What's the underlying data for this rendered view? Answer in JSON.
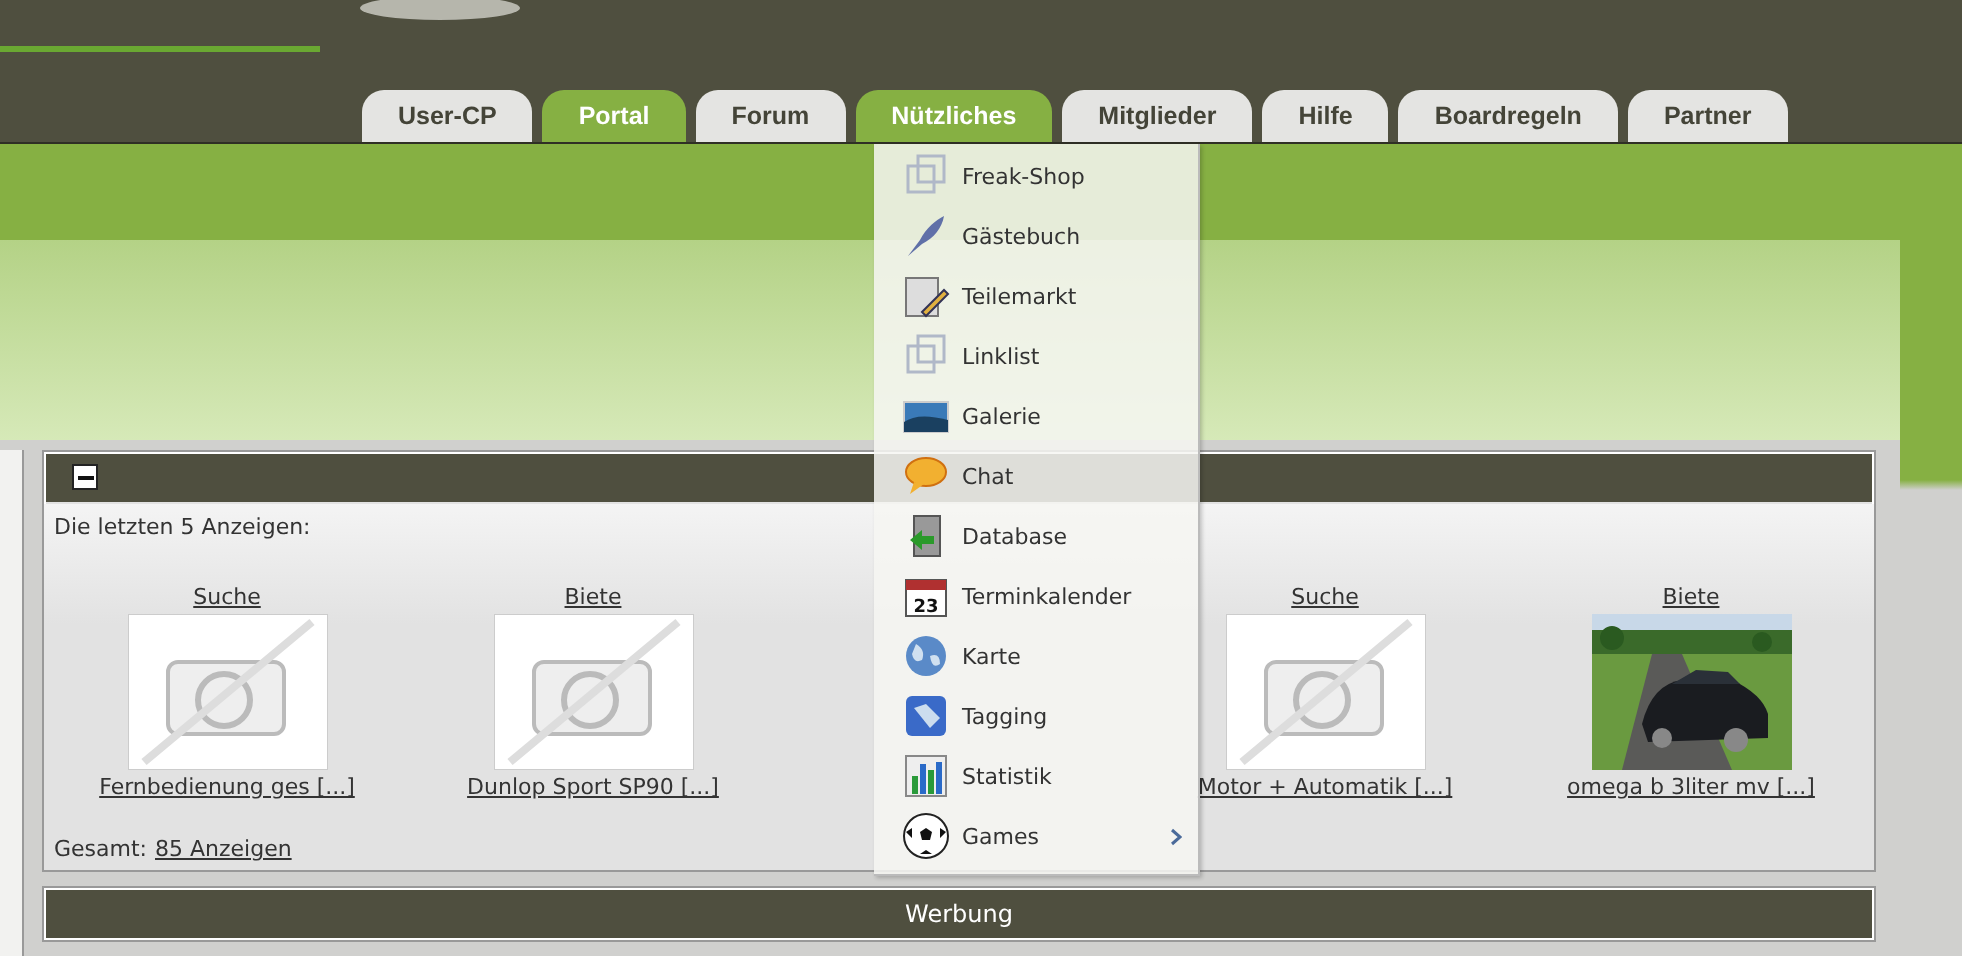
{
  "tabs": [
    {
      "label": "User-CP",
      "selected": false
    },
    {
      "label": "Portal",
      "selected": true
    },
    {
      "label": "Forum",
      "selected": false
    },
    {
      "label": "Nützliches",
      "selected": true
    },
    {
      "label": "Mitglieder",
      "selected": false
    },
    {
      "label": "Hilfe",
      "selected": false
    },
    {
      "label": "Boardregeln",
      "selected": false
    },
    {
      "label": "Partner",
      "selected": false
    }
  ],
  "menu": {
    "items": [
      {
        "label": "Freak-Shop"
      },
      {
        "label": "Gästebuch"
      },
      {
        "label": "Teilemarkt"
      },
      {
        "label": "Linklist"
      },
      {
        "label": "Galerie"
      },
      {
        "label": "Chat"
      },
      {
        "label": "Database"
      },
      {
        "label": "Terminkalender",
        "icon_label": "23"
      },
      {
        "label": "Karte"
      },
      {
        "label": "Tagging"
      },
      {
        "label": "Statistik"
      },
      {
        "label": "Games",
        "submenu": true
      }
    ]
  },
  "ads_panel": {
    "collapsed": false,
    "intro": "Die letzten 5 Anzeigen:",
    "ads": [
      {
        "kind": "ad",
        "type": "Suche",
        "title": "Fernbedienung ges [...]",
        "has_photo": false
      },
      {
        "kind": "ad",
        "type": "Biete",
        "title": "Dunlop Sport SP90 [...]",
        "has_photo": false
      },
      {
        "kind": "covered"
      },
      {
        "kind": "ad",
        "type": "Suche",
        "title": "Motor + Automatik [...]",
        "has_photo": false
      },
      {
        "kind": "ad",
        "type": "Biete",
        "title": "omega b 3liter mv [...]",
        "has_photo": true
      }
    ],
    "total_label": "Gesamt:",
    "total_link": "85 Anzeigen"
  },
  "werbung_panel": {
    "title": "Werbung"
  }
}
